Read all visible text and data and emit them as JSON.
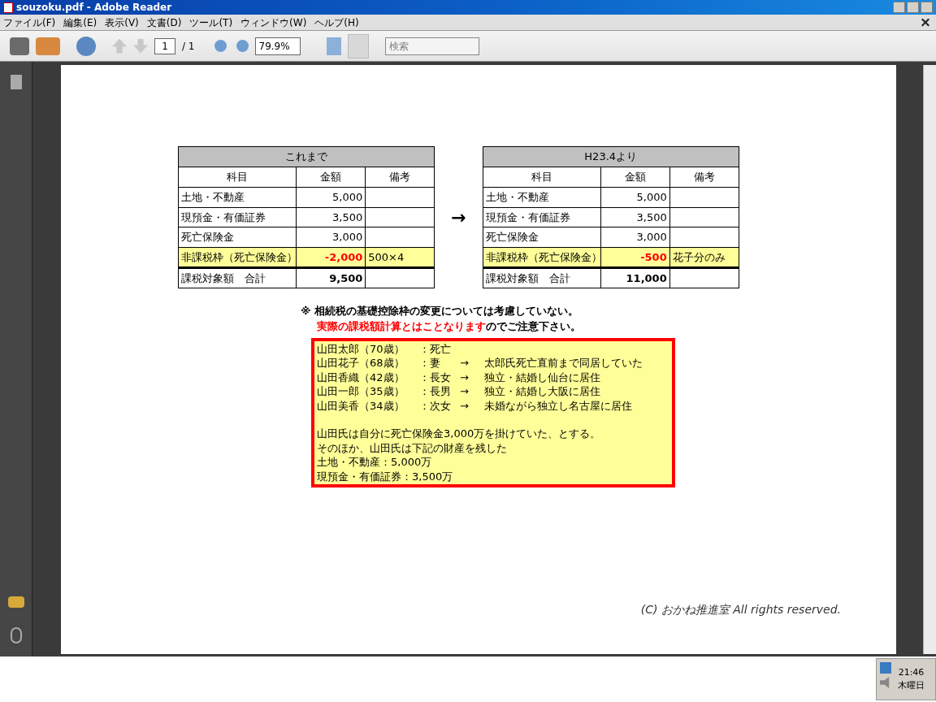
{
  "window": {
    "title": "souzoku.pdf - Adobe Reader"
  },
  "menu": [
    "ファイル(F)",
    "編集(E)",
    "表示(V)",
    "文書(D)",
    "ツール(T)",
    "ウィンドウ(W)",
    "ヘルプ(H)"
  ],
  "toolbar": {
    "page": "1",
    "page_total": "/ 1",
    "zoom": "79.9%",
    "search_placeholder": "検索"
  },
  "tables": [
    {
      "title": "これまで",
      "columns": [
        "科目",
        "金額",
        "備考"
      ],
      "rows": [
        {
          "kind": "normal",
          "cells": [
            "土地・不動産",
            "5,000",
            ""
          ]
        },
        {
          "kind": "normal",
          "cells": [
            "現預金・有価証券",
            "3,500",
            ""
          ]
        },
        {
          "kind": "normal",
          "cells": [
            "死亡保険金",
            "3,000",
            ""
          ]
        },
        {
          "kind": "highlight",
          "cells": [
            "非課税枠（死亡保険金）",
            "-2,000",
            "500×4"
          ]
        },
        {
          "kind": "total",
          "cells": [
            "課税対象額　合計",
            "9,500",
            ""
          ]
        }
      ]
    },
    {
      "title": "H23.4より",
      "columns": [
        "科目",
        "金額",
        "備考"
      ],
      "rows": [
        {
          "kind": "normal",
          "cells": [
            "土地・不動産",
            "5,000",
            ""
          ]
        },
        {
          "kind": "normal",
          "cells": [
            "現預金・有価証券",
            "3,500",
            ""
          ]
        },
        {
          "kind": "normal",
          "cells": [
            "死亡保険金",
            "3,000",
            ""
          ]
        },
        {
          "kind": "highlight",
          "cells": [
            "非課税枠（死亡保険金）",
            "-500",
            "花子分のみ"
          ]
        },
        {
          "kind": "total",
          "cells": [
            "課税対象額　合計",
            "11,000",
            ""
          ]
        }
      ]
    }
  ],
  "arrow": "→",
  "note": {
    "mark": "※",
    "line1": "相続税の基礎控除枠の変更については考慮していない。",
    "line2": [
      {
        "text": "実際の課税額計算とはことなります",
        "color": "#ff0000"
      },
      {
        "text": "のでご注意下さい。",
        "color": "#000000"
      }
    ]
  },
  "box": {
    "people": [
      {
        "name": "山田太郎（70歳）",
        "role": "：死亡"
      },
      {
        "name": "山田花子（68歳）",
        "role": "：妻",
        "arrow": "→",
        "detail": "太郎氏死亡直前まで同居していた"
      },
      {
        "name": "山田香織（42歳）",
        "role": "：長女",
        "arrow": "→",
        "detail": "独立・結婚し仙台に居住"
      },
      {
        "name": "山田一郎（35歳）",
        "role": "：長男",
        "arrow": "→",
        "detail": "独立・結婚し大阪に居住"
      },
      {
        "name": "山田美香（34歳）",
        "role": "：次女",
        "arrow": "→",
        "detail": "未婚ながら独立し名古屋に居住"
      }
    ],
    "facts": [
      "山田氏は自分に死亡保険金3,000万を掛けていた、とする。",
      "そのほか、山田氏は下記の財産を残した",
      "土地・不動産：5,000万",
      "現預金・有価証券：3,500万"
    ]
  },
  "footer": "(C) おかね推進室 All rights reserved.",
  "tray": {
    "time": "21:46",
    "day": "木曜日"
  }
}
